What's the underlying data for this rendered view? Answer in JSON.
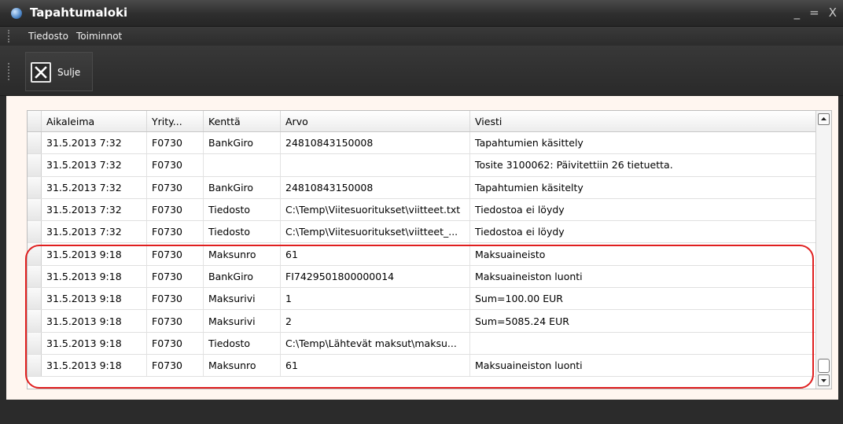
{
  "window": {
    "title": "Tapahtumaloki",
    "controls": [
      "_",
      "=",
      "X"
    ]
  },
  "menu": [
    "Tiedosto",
    "Toiminnot"
  ],
  "toolbar": {
    "close_label": "Sulje",
    "close_icon": "close-box-icon"
  },
  "grid": {
    "columns": [
      "Aikaleima",
      "Yrity...",
      "Kenttä",
      "Arvo",
      "Viesti"
    ],
    "rows": [
      [
        "31.5.2013 7:32",
        "F0730",
        "BankGiro",
        "24810843150008",
        "Tapahtumien käsittely"
      ],
      [
        "31.5.2013 7:32",
        "F0730",
        "",
        "",
        "Tosite 3100062: Päivitettiin 26 tietuetta."
      ],
      [
        "31.5.2013 7:32",
        "F0730",
        "BankGiro",
        "24810843150008",
        "Tapahtumien käsitelty"
      ],
      [
        "31.5.2013 7:32",
        "F0730",
        "Tiedosto",
        "C:\\Temp\\Viitesuoritukset\\viitteet.txt",
        "Tiedostoa ei löydy"
      ],
      [
        "31.5.2013 7:32",
        "F0730",
        "Tiedosto",
        "C:\\Temp\\Viitesuoritukset\\viitteet_...",
        "Tiedostoa ei löydy"
      ],
      [
        "31.5.2013 9:18",
        "F0730",
        "Maksunro",
        "61",
        "Maksuaineisto"
      ],
      [
        "31.5.2013 9:18",
        "F0730",
        "BankGiro",
        "FI7429501800000014",
        "Maksuaineiston luonti"
      ],
      [
        "31.5.2013 9:18",
        "F0730",
        "Maksurivi",
        "1",
        "Sum=100.00 EUR"
      ],
      [
        "31.5.2013 9:18",
        "F0730",
        "Maksurivi",
        "2",
        "Sum=5085.24 EUR"
      ],
      [
        "31.5.2013 9:18",
        "F0730",
        "Tiedosto",
        "C:\\Temp\\Lähtevät maksut\\maksu...",
        ""
      ],
      [
        "31.5.2013 9:18",
        "F0730",
        "Maksunro",
        "61",
        "Maksuaineiston luonti"
      ]
    ]
  },
  "colors": {
    "highlight": "#e01f1f",
    "chrome": "#2b2b2b",
    "content_bg": "#fff6f0"
  }
}
